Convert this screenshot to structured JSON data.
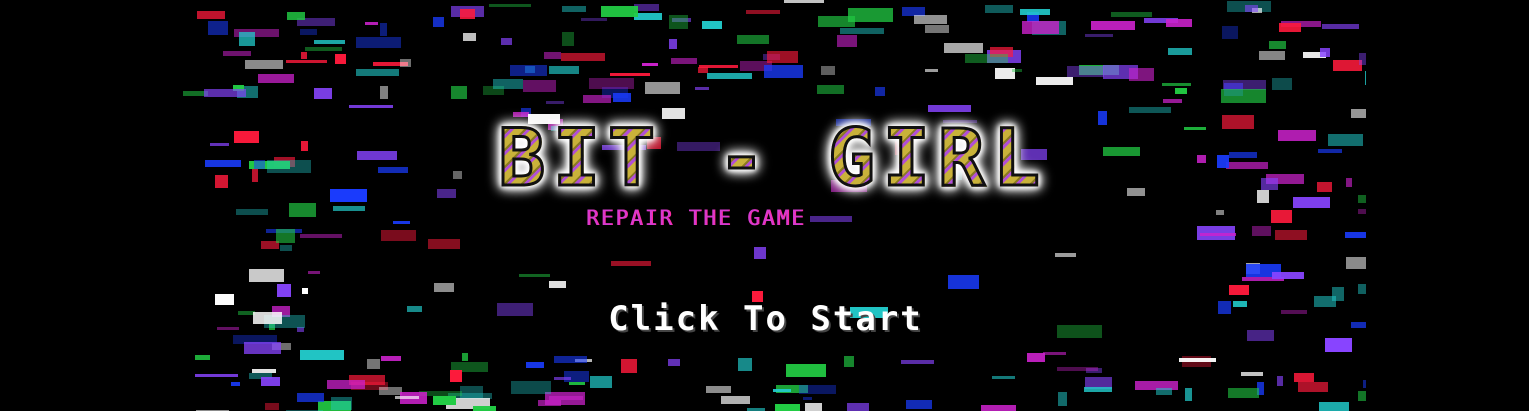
{
  "game": {
    "title": "BIT - GIRL",
    "subtitle": "REPAIR THE GAME",
    "start_prompt": "Click To Start"
  },
  "colors": {
    "background": "#000000",
    "title_fill": "#c9b23a",
    "title_stripe": "#b14fd6",
    "title_glow": "#ffffff",
    "subtitle": "#d63ad0",
    "start_prompt": "#ffffff",
    "glitch_palette": [
      "#ff1a3c",
      "#1a3cff",
      "#22cc44",
      "#cc22cc",
      "#22cccc",
      "#ffffff",
      "#8844ff"
    ]
  }
}
